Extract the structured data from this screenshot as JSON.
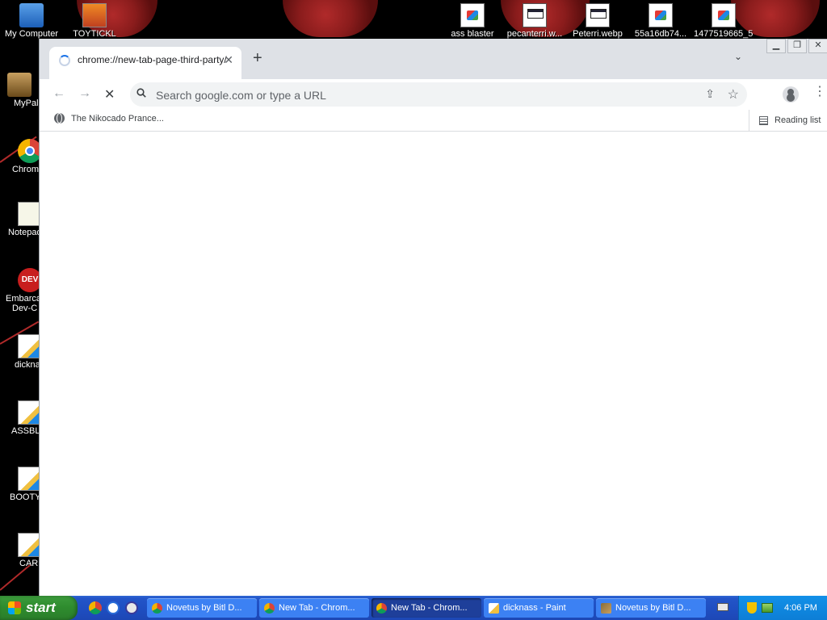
{
  "desktop": {
    "top_icons": [
      {
        "label": "My Computer",
        "icon": "my-computer-icon"
      },
      {
        "label": "TOYTICKL",
        "icon": "gift-file-icon"
      },
      {
        "label": "ass blaster",
        "icon": "image-file-icon"
      },
      {
        "label": "pecanterri.w...",
        "icon": "window-file-icon"
      },
      {
        "label": "Peterri.webp",
        "icon": "window-file-icon"
      },
      {
        "label": "55a16db74...",
        "icon": "image-file-icon"
      },
      {
        "label": "1477519665_5...",
        "icon": "image-file-icon"
      }
    ],
    "left_icons": [
      {
        "label": "MyPal",
        "icon": "mypal-icon"
      },
      {
        "label": "Chrom",
        "icon": "chrome-shortcut-icon"
      },
      {
        "label": "Notepad",
        "icon": "notepad-icon"
      },
      {
        "label": "Embarca",
        "label2": "Dev-C",
        "icon": "embarcadero-dev-icon",
        "badge": "DEV"
      },
      {
        "label": "dickna",
        "icon": "paint-file-icon"
      },
      {
        "label": "ASSBLA",
        "icon": "paint-file-icon"
      },
      {
        "label": "BOOTY",
        "icon": "paint-file-icon"
      },
      {
        "label": "CARI",
        "icon": "paint-file-icon"
      }
    ]
  },
  "browser": {
    "tab": {
      "title": "chrome://new-tab-page-third-party/",
      "close": "✕"
    },
    "new_tab": "+",
    "tab_search": "⌄",
    "window_buttons": {
      "minimize": "▁",
      "maximize": "❐",
      "close": "✕"
    },
    "toolbar": {
      "back": "←",
      "forward": "→",
      "stop": "✕",
      "omnibox_placeholder": "Search google.com or type a URL",
      "omnibox_value": "",
      "share": "⇪",
      "star": "☆",
      "menu": "⋮"
    },
    "bookmarks": {
      "items": [
        {
          "label": "The Nikocado Prance..."
        }
      ],
      "reading_list": "Reading list"
    }
  },
  "taskbar": {
    "start_label": "start",
    "tasks": [
      {
        "label": "Novetus by Bitl D...",
        "icon": "chrome",
        "active": false
      },
      {
        "label": "New Tab - Chrom...",
        "icon": "chrome",
        "active": false
      },
      {
        "label": "New Tab - Chrom...",
        "icon": "chrome",
        "active": true
      },
      {
        "label": "dicknass - Paint",
        "icon": "paint",
        "active": false
      },
      {
        "label": "Novetus by Bitl D...",
        "icon": "novetus",
        "active": false
      }
    ],
    "clock": "4:06 PM"
  }
}
